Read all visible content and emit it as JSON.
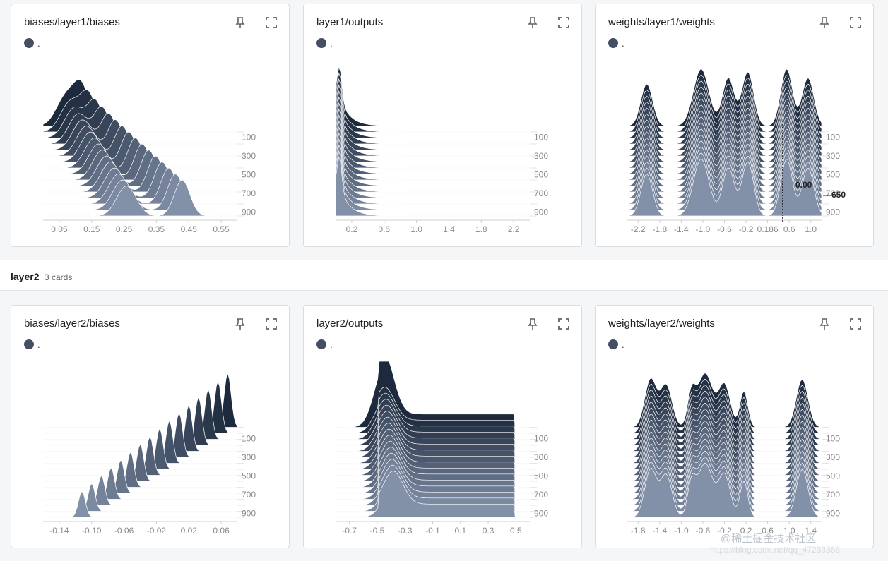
{
  "group": {
    "name": "layer2",
    "count": "3 cards"
  },
  "legend_label": ".",
  "icons": {
    "pin": "pin-icon",
    "expand": "expand-icon"
  },
  "colors": {
    "dark": "#1d2a3d",
    "light": "#8290a8",
    "tick": "#8a8a8a"
  },
  "cards": [
    {
      "title": "biases/layer1/biases",
      "x_ticks": [
        "0.05",
        "0.15",
        "0.25",
        "0.35",
        "0.45",
        "0.55"
      ],
      "y_ticks": [
        "100",
        "300",
        "500",
        "700",
        "900"
      ]
    },
    {
      "title": "layer1/outputs",
      "x_ticks": [
        "0.2",
        "0.6",
        "1.0",
        "1.4",
        "1.8",
        "2.2"
      ],
      "y_ticks": [
        "100",
        "300",
        "500",
        "700",
        "900"
      ]
    },
    {
      "title": "weights/layer1/weights",
      "x_ticks": [
        "-2.2",
        "-1.8",
        "-1.4",
        "-1.0",
        "-0.6",
        "-0.2",
        "0.186",
        "0.6",
        "1.0"
      ],
      "y_ticks": [
        "100",
        "300",
        "500",
        "700",
        "900"
      ],
      "hover": {
        "x": "0.186",
        "value": "0.00",
        "step": "650"
      }
    },
    {
      "title": "biases/layer2/biases",
      "x_ticks": [
        "-0.14",
        "-0.10",
        "-0.06",
        "-0.02",
        "0.02",
        "0.06"
      ],
      "y_ticks": [
        "100",
        "300",
        "500",
        "700",
        "900"
      ]
    },
    {
      "title": "layer2/outputs",
      "x_ticks": [
        "-0.7",
        "-0.5",
        "-0.3",
        "-0.1",
        "0.1",
        "0.3",
        "0.5"
      ],
      "y_ticks": [
        "100",
        "300",
        "500",
        "700",
        "900"
      ]
    },
    {
      "title": "weights/layer2/weights",
      "x_ticks": [
        "-1.8",
        "-1.4",
        "-1.0",
        "-0.6",
        "-0.2",
        "0.2",
        "0.6",
        "1.0",
        "1.4"
      ],
      "y_ticks": [
        "100",
        "300",
        "500",
        "700",
        "900"
      ]
    }
  ],
  "watermark": {
    "text": "@稀土掘金技术社区",
    "sub": "https://blog.csdn.net/qq_47233366"
  }
}
